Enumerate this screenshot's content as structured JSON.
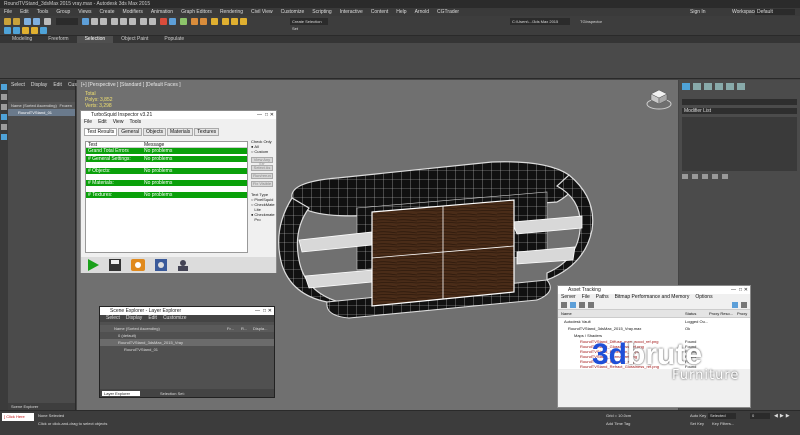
{
  "app": {
    "title": "RoundTVStand_3dsMax 2015 vray.max - Autodesk 3ds Max 2015"
  },
  "menubar": {
    "items": [
      "File",
      "Edit",
      "Tools",
      "Group",
      "Views",
      "Create",
      "Modifiers",
      "Animation",
      "Graph Editors",
      "Rendering",
      "Civil View",
      "Customize",
      "Scripting",
      "Interactive",
      "Content",
      "Help",
      "Arnold",
      "CGTrader"
    ]
  },
  "header_right": {
    "signin": "Sign In",
    "workspaces_label": "Workspaces:",
    "workspace_value": "Default"
  },
  "toolbar": {
    "selection_set": "Create Selection Set",
    "path": "C:\\Users\\...\\3ds Max 2015",
    "inspector": "TGInspector"
  },
  "ribbon_tabs": [
    "Modeling",
    "Freeform",
    "Selection",
    "Object Paint",
    "Populate"
  ],
  "ribbon_active": "Selection",
  "scene_explorer": {
    "menu": [
      "Select",
      "Display",
      "Edit",
      "Customize"
    ],
    "header_name": "Name (Sorted Ascending)",
    "header_frozen": "Frozen",
    "items": [
      "RoundTVStand_01"
    ],
    "bottom_label": "Scene Explorer"
  },
  "viewport": {
    "label": "[+] [Perspective ] [Standard ] [Default Faces ]",
    "stats_total_label": "Total",
    "stats_polys": "Polys:   3,852",
    "stats_verts": "Verts:   3,298"
  },
  "turbosquid": {
    "title": "TurboSquid Inspector v3.21",
    "menu": [
      "File",
      "Edit",
      "View",
      "Tools"
    ],
    "tabs": [
      "Test Results",
      "General",
      "Objects",
      "Materials",
      "Textures"
    ],
    "col_test": "Test",
    "col_message": "Message",
    "rows": [
      {
        "test": "Grand Total Errors",
        "message": "No problems"
      },
      {
        "test": "# General Settings:",
        "message": "No problems"
      },
      {
        "test": "# Objects:",
        "message": "No problems"
      },
      {
        "test": "# Materials:",
        "message": "No problems"
      },
      {
        "test": "# Textures:",
        "message": "No problems"
      }
    ],
    "check_only_label": "Check Only",
    "opt_all": "All",
    "opt_custom": "Custom",
    "btn_view": "View Any Err",
    "btn_select": "Select As",
    "btn_run": "Run/rerun",
    "btn_fix": "Fix Visible",
    "text_type_label": "Text Type",
    "opt_pixelsquid": "PixelSquid",
    "opt_checkmate_lite": "CheckMate Lite",
    "opt_checkmate_pro": "Checkmate Pro"
  },
  "layer_explorer": {
    "title": "Scene Explorer - Layer Explorer",
    "menu": [
      "Select",
      "Display",
      "Edit",
      "Customize"
    ],
    "header_name": "Name (Sorted Ascending)",
    "header_frozen": "Fr...",
    "header_render": "R...",
    "header_display": "Displa...",
    "rows": [
      "0 (default)",
      "RoundTVStand_3dsMax_2015_Vray",
      "RoundTVStand_01"
    ],
    "footer_label": "Layer Explorer",
    "selection_set": "Selection Set:"
  },
  "asset_tracking": {
    "title": "Asset Tracking",
    "menu": [
      "Server",
      "File",
      "Paths",
      "Bitmap Performance and Memory",
      "Options"
    ],
    "col_name": "Name",
    "col_status": "Status",
    "col_proxy": "Proxy Reso...",
    "col_proxy2": "Proxy",
    "vault_row": "Autodesk Vault",
    "vault_status": "Logged Ou...",
    "file_row": "RoundTVStand_3dsMax_2015_Vray.max",
    "file_status": "Ok",
    "maps_row": "Maps / Shaders",
    "maps": [
      {
        "name": "RoundTVStand_Diffuse_map_wood_ref.png",
        "status": "Found"
      },
      {
        "name": "RoundTVStand_Glossiness_ref.png",
        "status": "Found"
      },
      {
        "name": "RoundTVStand_Reflection_ref.png",
        "status": "Found"
      },
      {
        "name": "RoundTVStand_Normal_ref.png",
        "status": "Found"
      },
      {
        "name": "RoundTVStand_Specular_ref.png",
        "status": "Found"
      },
      {
        "name": "RoundTVStand_Refract_Glossiness_ref.png",
        "status": "Found"
      }
    ]
  },
  "right_panel": {
    "modifier_list": "Modifier List"
  },
  "statusbar": {
    "status_line1": "None Selected",
    "status_line2": "Click or click-and-drag to select objects",
    "maxscript": "[ Click Here",
    "grid": "Grid = 10.0cm",
    "autokey": "Auto Key",
    "selected": "Selected",
    "setkey": "Set Key",
    "keyfilters": "Key Filters...",
    "addtimetag": "Add Time Tag",
    "frame": "0"
  },
  "watermark": {
    "brand_3d": "3d",
    "brand_brute": "brute",
    "sub": "Furniture"
  },
  "colors": {
    "ok_green": "#0aa00a",
    "brand_blue": "#1e4fd8",
    "viewport_bg": "#707070"
  }
}
